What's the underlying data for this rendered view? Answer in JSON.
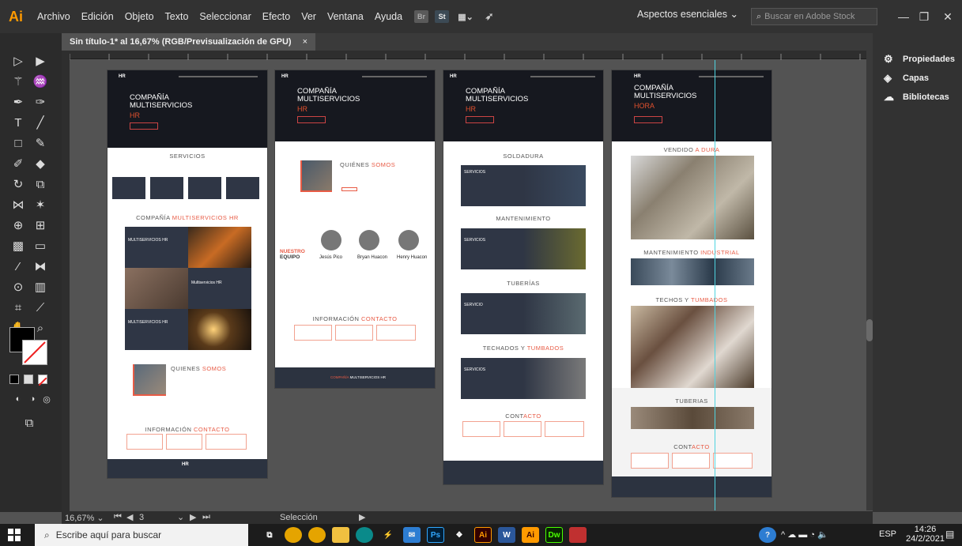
{
  "menubar": {
    "app_logo": "Ai",
    "items": [
      "Archivo",
      "Edición",
      "Objeto",
      "Texto",
      "Seleccionar",
      "Efecto",
      "Ver",
      "Ventana",
      "Ayuda"
    ],
    "workspace": "Aspectos esenciales",
    "stock_placeholder": "Buscar en Adobe Stock"
  },
  "tab": {
    "title": "Sin título-1* al 16,67% (RGB/Previsualización de GPU)",
    "close": "×"
  },
  "right_panel": {
    "items": [
      "Propiedades",
      "Capas",
      "Bibliotecas"
    ]
  },
  "statusbar": {
    "zoom": "16,67%",
    "artboard": "3",
    "tool": "Selección"
  },
  "taskbar": {
    "search_placeholder": "Escribe aquí para buscar",
    "lang": "ESP",
    "time": "14:26",
    "date": "24/2/2021"
  },
  "artboards": {
    "hero_title_line1": "COMPAÑÍA",
    "hero_title_line2": "MULTISERVICIOS",
    "hero_sub_hr": "HR",
    "hero_sub_hora": "HORA",
    "logo": "HR",
    "ab1": {
      "servicios": "SERVICIOS",
      "company_a": "COMPAÑÍA ",
      "company_b": "MULTISERVICIOS HR",
      "card_labels": [
        "MULTISERVICIOS HR",
        "Multiservicios HR",
        "MULTISERVICIOS HR"
      ],
      "quienes_a": "QUIENES ",
      "quienes_b": "SOMOS",
      "info_a": "INFORMACIÓN ",
      "info_b": "CONTACTO"
    },
    "ab2": {
      "quienes_a": "QUIÉNES ",
      "quienes_b": "SOMOS",
      "equipo_a": "NUESTRO",
      "equipo_b": "EQUIPO",
      "team": [
        "Jesús Pico",
        "Bryan Huacon",
        "Henry Huacon"
      ],
      "info_a": "INFORMACIÓN ",
      "info_b": "CONTACTO",
      "footer_a": "COMPAÑÍA ",
      "footer_b": "MULTISERVICIOS HR"
    },
    "ab3": {
      "sections": [
        "SOLDADURA",
        "MANTENIMIENTO",
        "TUBERÍAS"
      ],
      "techados_a": "TECHADOS Y ",
      "techados_b": "TUMBADOS",
      "card_labels": [
        "SERVICIOS",
        "SERVICIOS",
        "SERVICIO",
        "SERVICIOS"
      ],
      "contacto_a": "CONT",
      "contacto_b": "ACTO"
    },
    "ab4": {
      "vendido_a": "VENDIDO ",
      "vendido_b": "A DURA",
      "mant_a": "MANTENIMIENTO ",
      "mant_b": "INDUSTRIAL",
      "techos_a": "TECHOS Y ",
      "techos_b": "TUMBADOS",
      "tuberias": "TUBERIAS",
      "contacto_a": "CONT",
      "contacto_b": "ACTO"
    }
  },
  "colors": {
    "accent": "#e85b45",
    "ai_orange": "#ff9a00",
    "ui_dark": "#323232",
    "canvas": "#535353"
  }
}
